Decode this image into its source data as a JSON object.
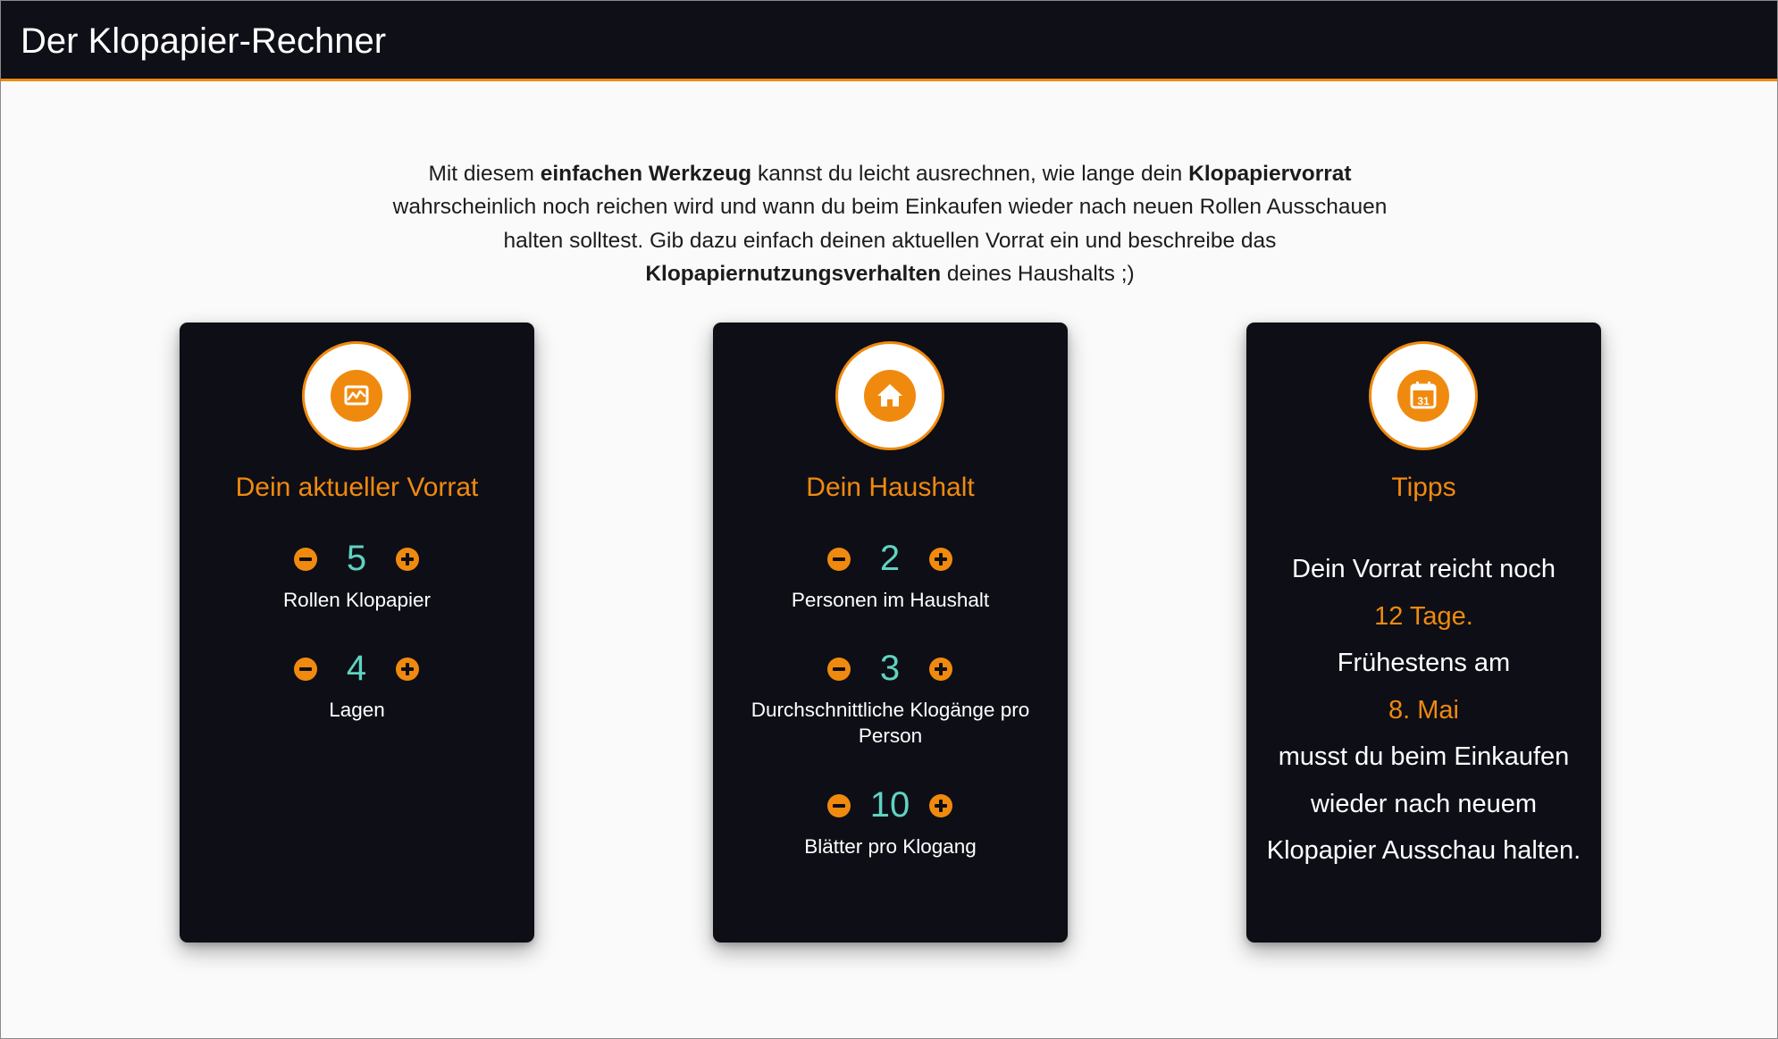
{
  "header": {
    "title": "Der Klopapier-Rechner"
  },
  "intro": {
    "part1": "Mit diesem ",
    "bold1": "einfachen Werkzeug",
    "part2": " kannst du leicht ausrechnen, wie lange dein ",
    "bold2": "Klopapiervorrat",
    "part3": " wahrscheinlich noch reichen wird und wann du beim Einkaufen wieder nach neuen Rollen Ausschauen halten solltest. Gib dazu einfach deinen aktuellen Vorrat ein und beschreibe das ",
    "bold3": "Klopapiernutzungsverhalten",
    "part4": " deines Haushalts ;)"
  },
  "cards": {
    "vorrat": {
      "icon": "chart-icon",
      "title": "Dein aktueller Vorrat",
      "rollen": {
        "value": "5",
        "label": "Rollen Klopapier"
      },
      "lagen": {
        "value": "4",
        "label": "Lagen"
      }
    },
    "haushalt": {
      "icon": "home-icon",
      "title": "Dein Haushalt",
      "personen": {
        "value": "2",
        "label": "Personen im Haushalt"
      },
      "kloggaenge": {
        "value": "3",
        "label": "Durchschnittliche Klogänge pro Person"
      },
      "blaetter": {
        "value": "10",
        "label": "Blätter pro Klogang"
      }
    },
    "tipps": {
      "icon": "calendar-icon",
      "calendar_day": "31",
      "title": "Tipps",
      "line1": "Dein Vorrat reicht noch",
      "days": "12 Tage.",
      "line2": "Frühestens am",
      "date": "8. Mai",
      "line3": "musst du beim Einkaufen wieder nach neuem Klopapier Ausschau halten."
    }
  },
  "colors": {
    "accent": "#f08a0e",
    "value": "#5fd3c1",
    "card_bg": "#0e0e17",
    "header_bg": "#0f0f17"
  }
}
